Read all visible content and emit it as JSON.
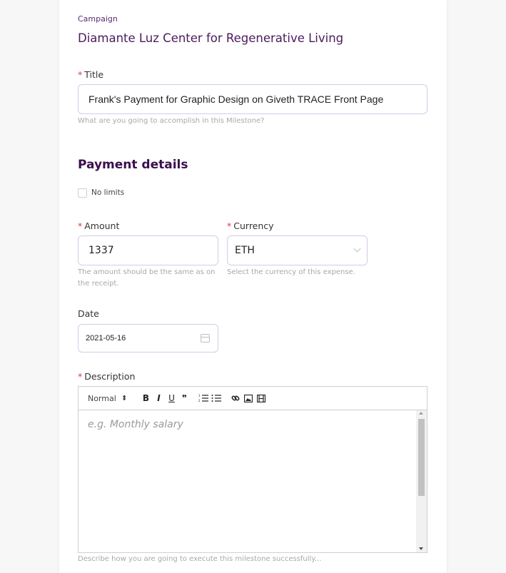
{
  "campaign": {
    "label": "Campaign",
    "name": "Diamante Luz Center for Regenerative Living"
  },
  "title_field": {
    "required_mark": "*",
    "label": "Title",
    "value": "Frank's Payment for Graphic Design on Giveth TRACE Front Page",
    "hint": "What are you going to accomplish in this Milestone?"
  },
  "payment": {
    "section_title": "Payment details",
    "no_limits_label": "No limits",
    "no_limits_checked": false,
    "amount": {
      "required_mark": "*",
      "label": "Amount",
      "value": "1337",
      "hint": "The amount should be the same as on the receipt."
    },
    "currency": {
      "required_mark": "*",
      "label": "Currency",
      "value": "ETH",
      "hint": "Select the currency of this expense."
    },
    "date": {
      "label": "Date",
      "value": "2021-05-16"
    }
  },
  "description": {
    "required_mark": "*",
    "label": "Description",
    "toolbar": {
      "header_select": "Normal",
      "header_arrows": "⬍",
      "bold": "B",
      "italic": "I",
      "underline": "U",
      "blockquote": "❞",
      "ordered_list": "☰",
      "bullet_list": "☷",
      "link_icon": "link-icon",
      "image_icon": "image-icon",
      "video_icon": "video-icon"
    },
    "placeholder": "e.g. Monthly salary",
    "hint": "Describe how you are going to execute this milestone successfully..."
  },
  "colors": {
    "brand_purple": "#4a1a5c",
    "required_red": "#e53935",
    "input_border": "#d8c8e6"
  }
}
